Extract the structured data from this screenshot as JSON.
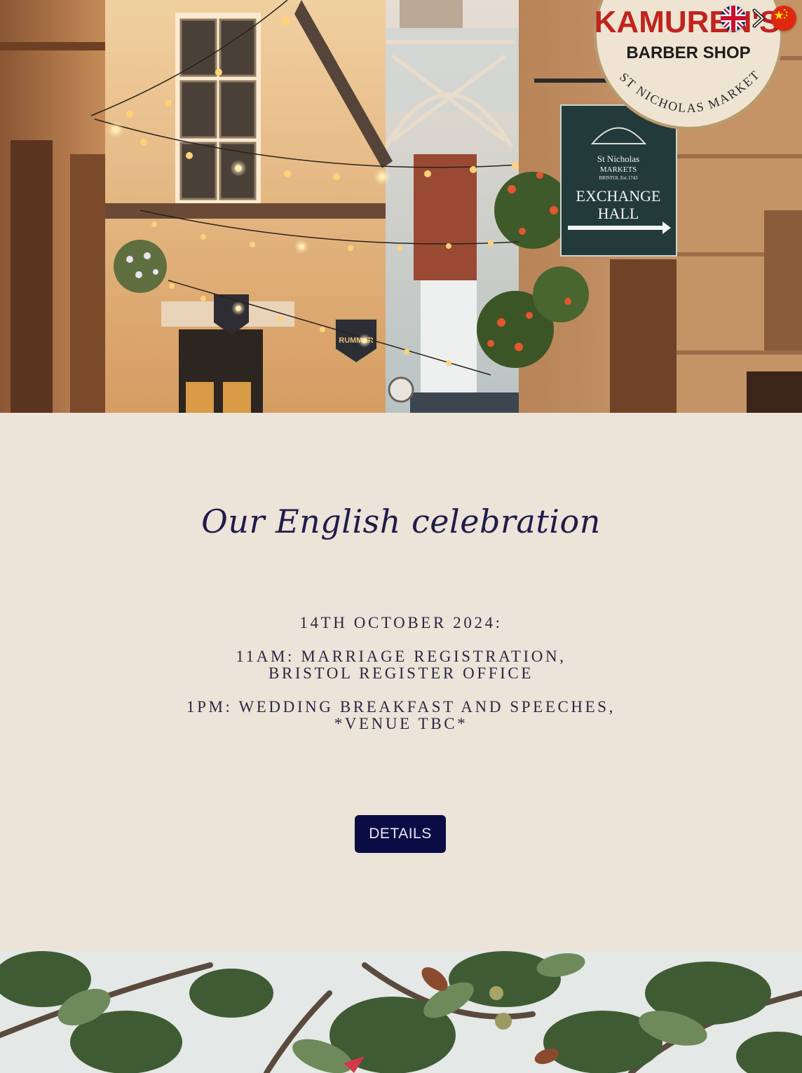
{
  "hero": {
    "image_alt": "St Nicholas Market alley in Bristol with string lights",
    "sign_barber_name": "KAMUREN'S",
    "sign_barber_sub": "BARBER SHOP",
    "sign_barber_arc": "ST NICHOLAS MARKET",
    "sign_market_1": "St Nicholas",
    "sign_market_2": "MARKETS",
    "sign_market_3": "BRISTOL  Est.1743",
    "sign_exchange_1": "EXCHANGE",
    "sign_exchange_2": "HALL",
    "sign_pub": "RUMMER"
  },
  "language_switcher": {
    "english_flag_icon": "uk-flag-icon",
    "chinese_flag_icon": "china-flag-icon",
    "switch_icon": "chevron-right-icon"
  },
  "event": {
    "title": "Our English celebration",
    "date_line": "14TH OCTOBER 2024:",
    "item1_line1": "11AM: MARRIAGE REGISTRATION,",
    "item1_line2": "BRISTOL REGISTER OFFICE",
    "item2_line1": "1PM: WEDDING BREAKFAST AND SPEECHES,",
    "item2_line2": "*VENUE TBC*",
    "details_button": "DETAILS"
  },
  "colors": {
    "background": "#ece3d9",
    "title": "#1f1c4a",
    "button_bg": "#0b0c45",
    "button_text": "#eae7ee"
  }
}
